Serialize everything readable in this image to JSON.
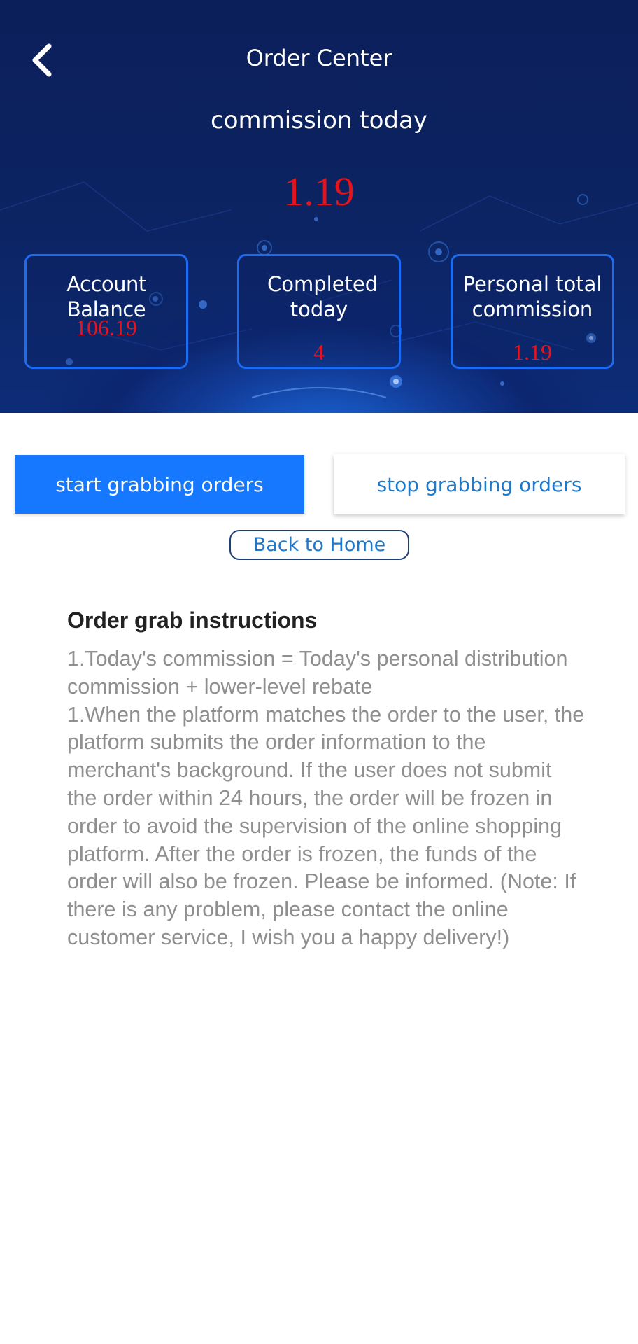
{
  "header": {
    "title": "Order Center",
    "subtitle": "commission today",
    "commission_value": "1.19"
  },
  "stats": [
    {
      "label": "Account Balance",
      "value": "106.19"
    },
    {
      "label": "Completed today",
      "value": "4"
    },
    {
      "label": "Personal total commission",
      "value": "1.19"
    }
  ],
  "actions": {
    "start_label": "start grabbing orders",
    "stop_label": "stop grabbing orders",
    "home_label": "Back to Home"
  },
  "instructions": {
    "title": "Order grab instructions",
    "line1": "1.Today's commission = Today's personal distribution commission + lower-level rebate",
    "line2": "1.When the platform matches the order to the user, the platform submits the order information to the merchant's background. If the user does not submit the order within 24 hours, the order will be frozen in order to avoid the supervision of the online shopping platform. After the order is frozen, the funds of the order will also be frozen. Please be informed. (Note: If there is any problem, please contact the online customer service, I wish you a happy delivery!)"
  },
  "colors": {
    "header_bg": "#0c2463",
    "accent_blue": "#1677ff",
    "value_red": "#e4141e",
    "box_border": "#1c6cf2"
  },
  "icons": {
    "back": "chevron-left-icon"
  }
}
